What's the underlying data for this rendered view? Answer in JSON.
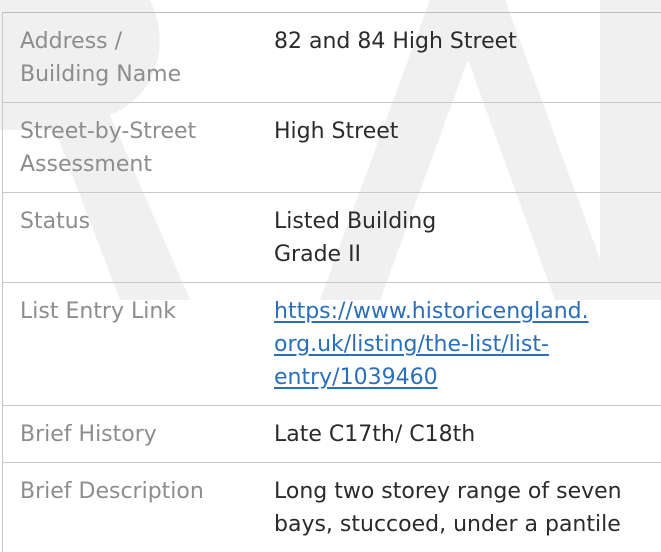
{
  "rows": [
    {
      "label_lines": [
        "Address /",
        "Building Name"
      ],
      "value_lines": [
        "82 and 84 High Street"
      ]
    },
    {
      "label_lines": [
        "Street-by-Street",
        "Assessment"
      ],
      "value_lines": [
        "High Street"
      ]
    },
    {
      "label_lines": [
        "Status"
      ],
      "value_lines": [
        "Listed Building",
        "Grade II"
      ]
    },
    {
      "label_lines": [
        "List Entry Link"
      ],
      "link_lines": [
        "https://www.historicengland.",
        "org.uk/listing/the-list/list-",
        "entry/1039460"
      ]
    },
    {
      "label_lines": [
        "Brief History"
      ],
      "value_lines": [
        "Late C17th/ C18th"
      ]
    },
    {
      "label_lines": [
        "Brief Description"
      ],
      "value_lines": [
        "Long two storey range of seven",
        "bays, stuccoed, under a pantile"
      ]
    }
  ],
  "colors": {
    "label_text": "#8d8d8d",
    "value_text": "#2b2b2b",
    "link": "#2a6fbb",
    "rule": "#c9c9c9",
    "watermark": "#efefef"
  }
}
